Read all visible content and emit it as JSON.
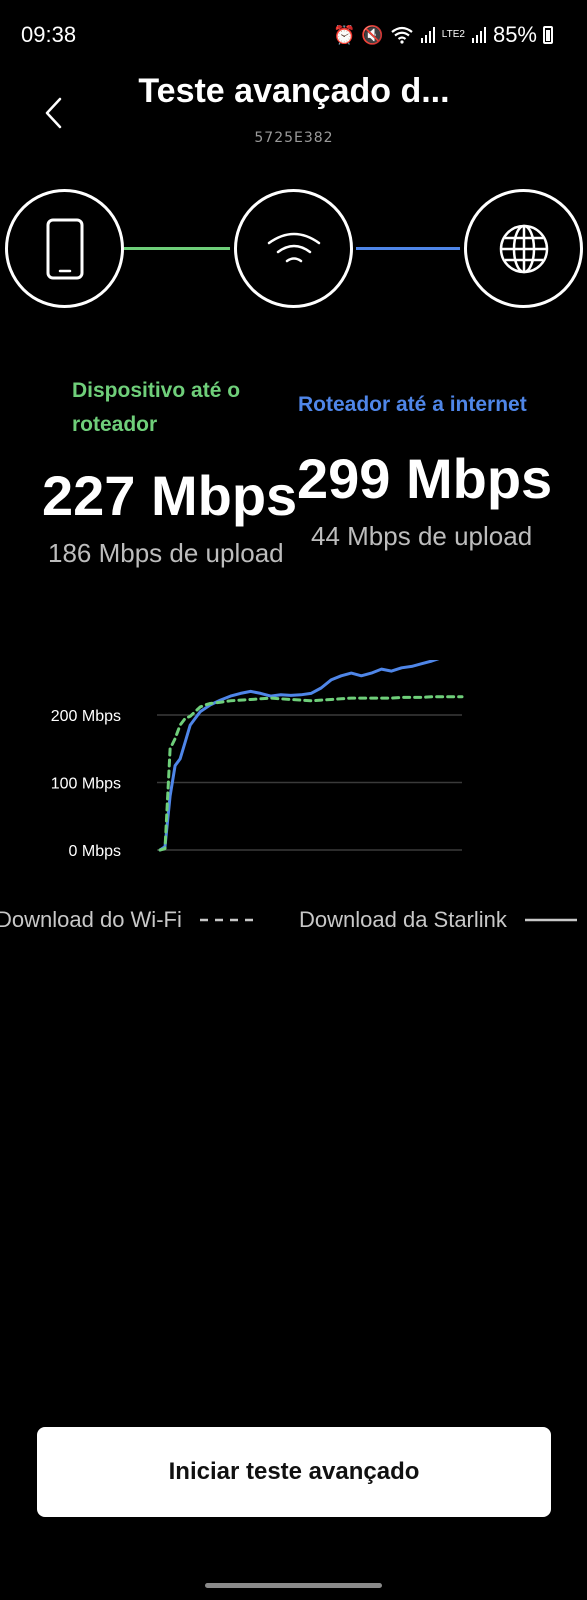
{
  "status_bar": {
    "time": "09:38",
    "battery_percent": "85%",
    "network_label": "LTE2"
  },
  "header": {
    "title": "Teste avançado d...",
    "serial": "5725E382"
  },
  "diagram": {
    "nodes": [
      {
        "icon": "phone-icon"
      },
      {
        "icon": "wifi-icon"
      },
      {
        "icon": "globe-icon"
      }
    ],
    "colors": {
      "device_link": "#6fcf7a",
      "internet_link": "#4f86e8"
    }
  },
  "stats": {
    "wifi": {
      "label": "Dispositivo até o roteador",
      "download": "227 Mbps",
      "upload": "186 Mbps de upload"
    },
    "starlink": {
      "label": "Roteador até a internet",
      "download": "299 Mbps",
      "upload": "44 Mbps de upload"
    }
  },
  "chart_data": {
    "type": "line",
    "y_ticks": [
      "200 Mbps",
      "100 Mbps",
      "0 Mbps"
    ],
    "y_tick_values": [
      200,
      100,
      0
    ],
    "ylim": [
      0,
      300
    ],
    "grid": true,
    "legend_position": "bottom",
    "series": [
      {
        "name": "Download do Wi-Fi",
        "style": "dashed",
        "color": "#6fcf7a",
        "x": [
          0,
          1,
          2,
          3,
          4,
          5,
          6,
          7,
          8,
          9,
          10,
          12,
          14,
          16,
          18,
          20,
          22,
          24,
          26,
          28,
          30,
          32,
          34,
          36,
          38,
          40,
          42,
          44,
          46,
          48,
          50,
          52,
          54,
          56,
          58,
          60
        ],
        "values": [
          0,
          2,
          150,
          165,
          185,
          195,
          198,
          205,
          212,
          215,
          217,
          219,
          221,
          222,
          223,
          224,
          225,
          224,
          223,
          222,
          221,
          222,
          223,
          224,
          225,
          225,
          225,
          225,
          225,
          226,
          226,
          226,
          227,
          227,
          227,
          227
        ]
      },
      {
        "name": "Download da Starlink",
        "style": "solid",
        "color": "#4f86e8",
        "x": [
          0,
          1,
          2,
          3,
          4,
          5,
          6,
          7,
          8,
          9,
          10,
          12,
          14,
          16,
          18,
          20,
          22,
          24,
          26,
          28,
          30,
          32,
          34,
          36,
          38,
          40,
          42,
          44,
          46,
          48,
          50,
          52,
          54,
          56,
          58,
          60
        ],
        "values": [
          0,
          5,
          80,
          125,
          135,
          160,
          185,
          195,
          205,
          210,
          215,
          222,
          228,
          232,
          235,
          232,
          228,
          230,
          229,
          230,
          232,
          240,
          252,
          258,
          262,
          258,
          262,
          268,
          265,
          270,
          272,
          276,
          280,
          285,
          292,
          299
        ]
      }
    ]
  },
  "actions": {
    "start_button_label": "Iniciar teste avançado"
  }
}
